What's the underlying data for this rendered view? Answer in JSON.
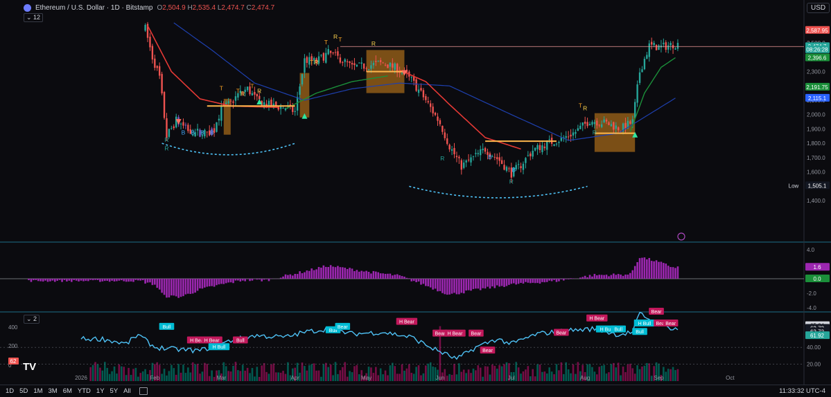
{
  "header": {
    "symbol_title": "Ethereum / U.S. Dollar · 1D · Bitstamp",
    "ohlc": [
      {
        "k": "O",
        "v": "2,504.9"
      },
      {
        "k": "H",
        "v": "2,535.4"
      },
      {
        "k": "L",
        "v": "2,474.7"
      },
      {
        "k": "C",
        "v": "2,474.7"
      }
    ],
    "indicator_count_main": "12",
    "indicator_count_lower": "2",
    "currency": "USD"
  },
  "colors": {
    "bg": "#0b0b0f",
    "up": "#26a69a",
    "down": "#ef5350",
    "accent_blue": "#2962ff",
    "ema_red": "#e53935",
    "ema_green": "#1b8f3a",
    "ema_blue": "#1e40af",
    "cloud": "#c77d1a",
    "hist": "#9c27b0",
    "rsi": "#4fc3f7",
    "bull_label": "#00bcd4",
    "bear_label": "#c2185b"
  },
  "price_axis": {
    "ticks": [
      "2,500.0",
      "2,400.0",
      "2,300.0",
      "2,200.0",
      "2,100.0",
      "2,000.0",
      "1,900.0",
      "1,800.0",
      "1,700.0",
      "1,600.0",
      "1,500.0",
      "1,400.0"
    ],
    "badges": [
      {
        "text": "2,587.95",
        "kind": "red",
        "value": 2587.95
      },
      {
        "text": "2,474.7",
        "kind": "teal",
        "value": 2474.7
      },
      {
        "text": "08:26:28",
        "kind": "teal",
        "value": 2453
      },
      {
        "text": "2,396.6",
        "kind": "green",
        "value": 2396.6
      },
      {
        "text": "2,191.75",
        "kind": "green",
        "value": 2191.75
      },
      {
        "text": "2,115.1",
        "kind": "blue",
        "value": 2115.1
      },
      {
        "text": "1,505.1",
        "kind": "dark",
        "value": 1505.1
      }
    ],
    "low_label": "Low"
  },
  "osc_axis": {
    "ticks": [
      "4.0",
      "-2.0",
      "-4.0"
    ],
    "badges": [
      {
        "text": "1.6",
        "kind": "purple",
        "value": 1.6
      },
      {
        "text": "0.0",
        "kind": "green",
        "value": 0.0
      }
    ]
  },
  "rsi_axis": {
    "right_ticks": [
      "40.00",
      "20.00"
    ],
    "left_ticks": [
      "400",
      "200",
      "0"
    ],
    "badges": [
      {
        "text": "65.84",
        "kind": "white",
        "value": 65.84
      },
      {
        "text": "62.72",
        "kind": "dark",
        "value": 62.72
      },
      {
        "text": "62.72",
        "kind": "dark",
        "value": 58.5
      },
      {
        "text": "61.92",
        "kind": "teal",
        "value": 54.0
      }
    ],
    "left_badge": "62"
  },
  "time_axis": [
    "2026",
    "Feb",
    "Mar",
    "Apr",
    "May",
    "Jun",
    "Jul",
    "Aug",
    "Sep",
    "Oct"
  ],
  "markers": {
    "top_letters": [
      "T",
      "T",
      "R",
      "T",
      "R",
      "T",
      "R",
      "T",
      "R",
      "T",
      "R",
      "T",
      "R"
    ],
    "bottom_letters": [
      "R",
      "B",
      "B",
      "B",
      "B",
      "R",
      "B",
      "B",
      "R",
      "R",
      "R"
    ],
    "rsi_labels": [
      "Bull",
      "H Bear",
      "H Bear",
      "Bull",
      "H Bull",
      "Bull",
      "Bear",
      "H Bear",
      "Bear",
      "H Bear",
      "Bear",
      "Bear",
      "Bear",
      "H Bull",
      "Bull",
      "H Bear",
      "Bull",
      "Bear",
      "H Bull",
      "Bear",
      "Bear"
    ]
  },
  "bottom_bar": {
    "timeframes": [
      "1D",
      "5D",
      "1M",
      "3M",
      "6M",
      "YTD",
      "1Y",
      "5Y",
      "All"
    ],
    "clock": "11:33:32 UTC-4"
  },
  "chart_data": {
    "type": "line",
    "title": "Ethereum / U.S. Dollar · 1D · Bitstamp",
    "price_anchors": [
      {
        "d": "2026-01-28",
        "p": 2600
      },
      {
        "d": "2026-01-31",
        "p": 2400
      },
      {
        "d": "2026-02-03",
        "p": 2260
      },
      {
        "d": "2026-02-06",
        "p": 1850
      },
      {
        "d": "2026-02-10",
        "p": 1960
      },
      {
        "d": "2026-02-14",
        "p": 1900
      },
      {
        "d": "2026-02-18",
        "p": 1880
      },
      {
        "d": "2026-02-22",
        "p": 1870
      },
      {
        "d": "2026-02-26",
        "p": 1900
      },
      {
        "d": "2026-03-01",
        "p": 2040
      },
      {
        "d": "2026-03-05",
        "p": 2080
      },
      {
        "d": "2026-03-08",
        "p": 2140
      },
      {
        "d": "2026-03-12",
        "p": 2180
      },
      {
        "d": "2026-03-16",
        "p": 2100
      },
      {
        "d": "2026-03-22",
        "p": 2060
      },
      {
        "d": "2026-03-28",
        "p": 2050
      },
      {
        "d": "2026-04-01",
        "p": 2020
      },
      {
        "d": "2026-04-05",
        "p": 2380
      },
      {
        "d": "2026-04-10",
        "p": 2370
      },
      {
        "d": "2026-04-15",
        "p": 2430
      },
      {
        "d": "2026-04-20",
        "p": 2390
      },
      {
        "d": "2026-04-25",
        "p": 2330
      },
      {
        "d": "2026-05-01",
        "p": 2340
      },
      {
        "d": "2026-05-08",
        "p": 2360
      },
      {
        "d": "2026-05-14",
        "p": 2320
      },
      {
        "d": "2026-05-20",
        "p": 2240
      },
      {
        "d": "2026-05-26",
        "p": 2100
      },
      {
        "d": "2026-06-01",
        "p": 1940
      },
      {
        "d": "2026-06-05",
        "p": 1780
      },
      {
        "d": "2026-06-10",
        "p": 1640
      },
      {
        "d": "2026-06-15",
        "p": 1700
      },
      {
        "d": "2026-06-20",
        "p": 1760
      },
      {
        "d": "2026-06-26",
        "p": 1680
      },
      {
        "d": "2026-07-01",
        "p": 1590
      },
      {
        "d": "2026-07-05",
        "p": 1650
      },
      {
        "d": "2026-07-10",
        "p": 1750
      },
      {
        "d": "2026-07-16",
        "p": 1800
      },
      {
        "d": "2026-07-22",
        "p": 1830
      },
      {
        "d": "2026-07-28",
        "p": 1880
      },
      {
        "d": "2026-08-03",
        "p": 1960
      },
      {
        "d": "2026-08-10",
        "p": 1940
      },
      {
        "d": "2026-08-16",
        "p": 1900
      },
      {
        "d": "2026-08-21",
        "p": 1950
      },
      {
        "d": "2026-08-24",
        "p": 2300
      },
      {
        "d": "2026-08-28",
        "p": 2480
      },
      {
        "d": "2026-09-02",
        "p": 2470
      },
      {
        "d": "2026-09-07",
        "p": 2490
      }
    ],
    "histogram_anchors": [
      {
        "d": "2026-01-28",
        "v": -0.5
      },
      {
        "d": "2026-02-01",
        "v": -0.8
      },
      {
        "d": "2026-02-05",
        "v": -2.4
      },
      {
        "d": "2026-02-12",
        "v": -2.5
      },
      {
        "d": "2026-02-20",
        "v": -1.5
      },
      {
        "d": "2026-03-01",
        "v": -0.8
      },
      {
        "d": "2026-03-10",
        "v": -0.2
      },
      {
        "d": "2026-03-20",
        "v": -0.2
      },
      {
        "d": "2026-04-05",
        "v": 1.0
      },
      {
        "d": "2026-04-15",
        "v": 1.8
      },
      {
        "d": "2026-05-01",
        "v": 1.0
      },
      {
        "d": "2026-05-15",
        "v": 0.4
      },
      {
        "d": "2026-05-25",
        "v": -0.8
      },
      {
        "d": "2026-06-05",
        "v": -2.2
      },
      {
        "d": "2026-06-15",
        "v": -1.6
      },
      {
        "d": "2026-07-01",
        "v": -0.8
      },
      {
        "d": "2026-07-20",
        "v": -0.3
      },
      {
        "d": "2026-08-05",
        "v": 0.5
      },
      {
        "d": "2026-08-20",
        "v": 0.6
      },
      {
        "d": "2026-08-24",
        "v": 3.0
      },
      {
        "d": "2026-08-30",
        "v": 2.5
      },
      {
        "d": "2026-09-07",
        "v": 1.6
      }
    ],
    "rsi_anchors": [
      {
        "d": "2026-01-10",
        "v": 50
      },
      {
        "d": "2026-01-20",
        "v": 44
      },
      {
        "d": "2026-01-25",
        "v": 55
      },
      {
        "d": "2026-02-01",
        "v": 40
      },
      {
        "d": "2026-02-08",
        "v": 38
      },
      {
        "d": "2026-02-20",
        "v": 36
      },
      {
        "d": "2026-03-05",
        "v": 48
      },
      {
        "d": "2026-03-15",
        "v": 54
      },
      {
        "d": "2026-03-28",
        "v": 52
      },
      {
        "d": "2026-04-05",
        "v": 58
      },
      {
        "d": "2026-04-15",
        "v": 62
      },
      {
        "d": "2026-04-25",
        "v": 56
      },
      {
        "d": "2026-05-08",
        "v": 58
      },
      {
        "d": "2026-05-20",
        "v": 52
      },
      {
        "d": "2026-05-28",
        "v": 40
      },
      {
        "d": "2026-06-08",
        "v": 26
      },
      {
        "d": "2026-06-16",
        "v": 40
      },
      {
        "d": "2026-06-25",
        "v": 50
      },
      {
        "d": "2026-07-01",
        "v": 44
      },
      {
        "d": "2026-07-12",
        "v": 56
      },
      {
        "d": "2026-07-25",
        "v": 60
      },
      {
        "d": "2026-08-05",
        "v": 62
      },
      {
        "d": "2026-08-15",
        "v": 55
      },
      {
        "d": "2026-08-21",
        "v": 58
      },
      {
        "d": "2026-08-24",
        "v": 80
      },
      {
        "d": "2026-08-29",
        "v": 72
      },
      {
        "d": "2026-09-02",
        "v": 66
      },
      {
        "d": "2026-09-08",
        "v": 62
      }
    ],
    "ema_fast": [
      {
        "d": "2026-01-29",
        "p": 2620
      },
      {
        "d": "2026-02-08",
        "p": 2300
      },
      {
        "d": "2026-02-20",
        "p": 2110
      },
      {
        "d": "2026-03-05",
        "p": 2060
      },
      {
        "d": "2026-03-25",
        "p": 2050
      }
    ],
    "ema_fast_2": [
      {
        "d": "2026-05-15",
        "p": 2310
      },
      {
        "d": "2026-05-26",
        "p": 2230
      },
      {
        "d": "2026-06-05",
        "p": 2070
      },
      {
        "d": "2026-06-20",
        "p": 1840
      },
      {
        "d": "2026-07-05",
        "p": 1760
      }
    ],
    "ema_green": [
      {
        "d": "2026-03-28",
        "p": 2040
      },
      {
        "d": "2026-04-10",
        "p": 2150
      },
      {
        "d": "2026-04-25",
        "p": 2230
      },
      {
        "d": "2026-05-10",
        "p": 2270
      },
      {
        "d": "2026-08-20",
        "p": 1880
      },
      {
        "d": "2026-08-26",
        "p": 2150
      },
      {
        "d": "2026-09-02",
        "p": 2330
      },
      {
        "d": "2026-09-08",
        "p": 2396.6
      }
    ],
    "ema_blue": [
      {
        "d": "2026-02-09",
        "p": 2640
      },
      {
        "d": "2026-02-25",
        "p": 2450
      },
      {
        "d": "2026-03-15",
        "p": 2220
      },
      {
        "d": "2026-04-05",
        "p": 2100
      },
      {
        "d": "2026-04-25",
        "p": 2180
      },
      {
        "d": "2026-05-15",
        "p": 2220
      },
      {
        "d": "2026-06-05",
        "p": 2200
      },
      {
        "d": "2026-07-01",
        "p": 2000
      },
      {
        "d": "2026-07-25",
        "p": 1820
      },
      {
        "d": "2026-08-15",
        "p": 1870
      },
      {
        "d": "2026-09-08",
        "p": 2115.1
      }
    ],
    "last_price": 2474.7,
    "high_label": 2587.95,
    "low_label": 1505.1
  }
}
